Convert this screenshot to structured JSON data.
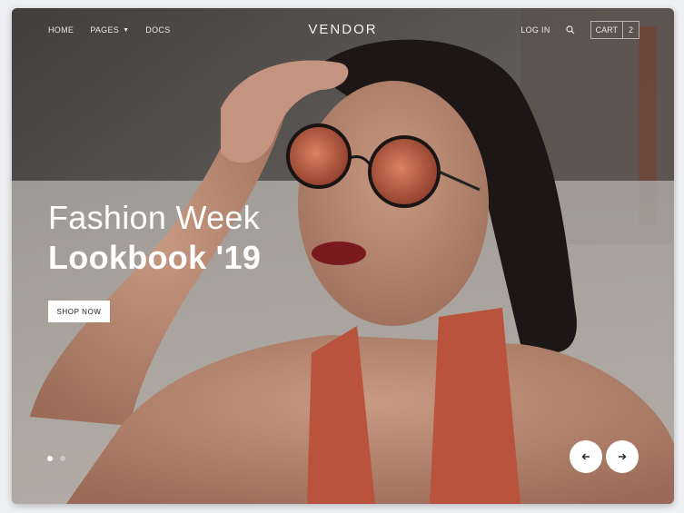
{
  "nav": {
    "home_label": "HOME",
    "pages_label": "PAGES",
    "docs_label": "DOCS",
    "brand": "VENDOR",
    "login_label": "LOG IN",
    "search_icon": "search-icon",
    "cart_label": "CART",
    "cart_count": "2"
  },
  "hero": {
    "title_line1": "Fashion Week",
    "title_line2": "Lookbook '19",
    "cta_label": "SHOP NOW",
    "slide_count": 2,
    "active_slide": 1
  },
  "colors": {
    "accent_dress": "#b9533d",
    "lens": "#c2553a",
    "text_light": "#ffffff"
  }
}
